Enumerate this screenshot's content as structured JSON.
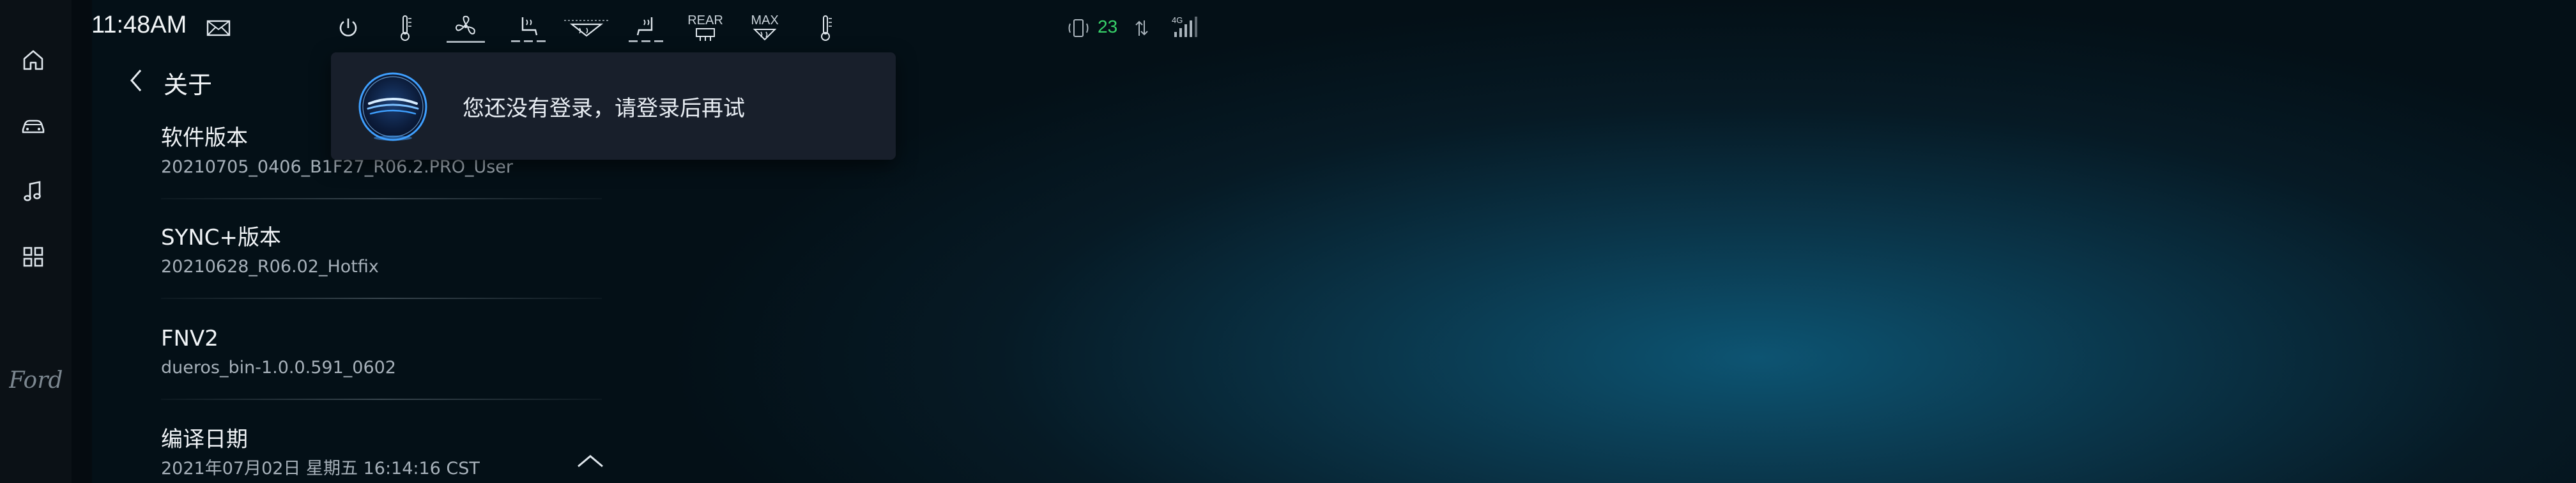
{
  "status_bar": {
    "time": "11:48AM",
    "rear_label": "REAR",
    "max_label": "MAX",
    "signal_value": "23",
    "network_label": "4G"
  },
  "page": {
    "title": "关于"
  },
  "info_list": [
    {
      "key": "软件版本",
      "value": "20210705_0406_B1F27_R06.2.PRO_User"
    },
    {
      "key": "SYNC+版本",
      "value": "20210628_R06.02_Hotfix"
    },
    {
      "key": "FNV2",
      "value": "dueros_bin-1.0.0.591_0602"
    },
    {
      "key": "编译日期",
      "value": "2021年07月02日  星期五 16:14:16 CST"
    }
  ],
  "toast": {
    "message": "您还没有登录，请登录后再试"
  },
  "brand": {
    "logo_text": "Ford"
  },
  "colors": {
    "accent_green": "#38d36a",
    "toast_bg": "#181f2b",
    "assistant_blue": "#3fa0ff"
  }
}
